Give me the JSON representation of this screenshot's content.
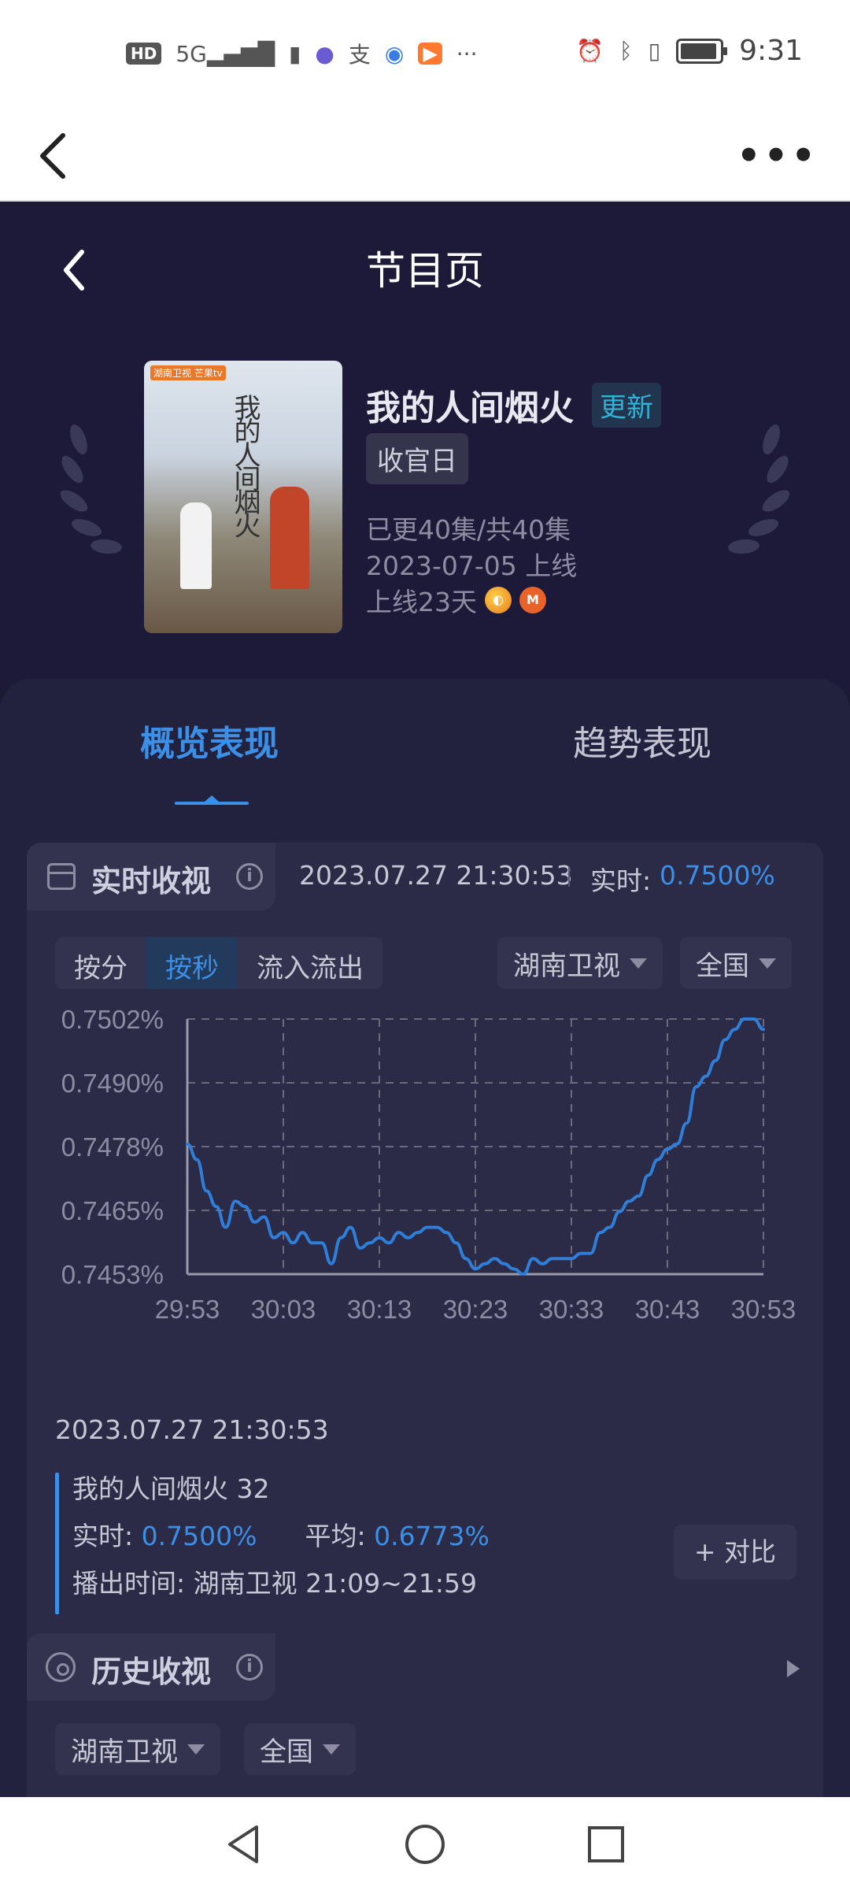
{
  "status_bar": {
    "time": "9:31",
    "left_icons": [
      "hd-icon",
      "signal-5g-icon",
      "battery-saver-icon",
      "app-icon-1",
      "alipay-icon",
      "app-icon-2",
      "app-icon-3",
      "more-notifications-icon"
    ],
    "right_icons": [
      "alarm-icon",
      "bluetooth-icon",
      "vibrate-icon",
      "battery-icon"
    ],
    "hd_label": "HD",
    "overflow": "···"
  },
  "top_nav": {
    "more": "•••"
  },
  "header": {
    "title": "节目页",
    "show_name": "我的人间烟火",
    "new_badge": "更新",
    "end_tag": "收官日",
    "episodes": "已更40集/共40集",
    "premiere": "2023-07-05 上线",
    "days_online": "上线23天",
    "platforms": [
      "hunan-tv-logo",
      "mango-tv-logo"
    ],
    "poster": {
      "title": "我的人间烟火",
      "badge": "湖南卫视 芒果tv"
    }
  },
  "tabs": [
    {
      "label": "概览表现",
      "active": true
    },
    {
      "label": "趋势表现",
      "active": false
    }
  ],
  "realtime": {
    "title": "实时收视",
    "timestamp": "2023.07.27 21:30:53",
    "live_label": "实时:",
    "live_value": "0.7500%",
    "segments": [
      {
        "label": "按分",
        "active": false
      },
      {
        "label": "按秒",
        "active": true
      },
      {
        "label": "流入流出",
        "active": false
      }
    ],
    "channel": "湖南卫视",
    "region": "全国"
  },
  "chart_data": {
    "type": "line",
    "x_ticks": [
      "29:53",
      "30:03",
      "30:13",
      "30:23",
      "30:33",
      "30:43",
      "30:53"
    ],
    "y_ticks": [
      "0.7502%",
      "0.7490%",
      "0.7478%",
      "0.7465%",
      "0.7453%"
    ],
    "ylim": [
      0.7453,
      0.7502
    ],
    "grid": true,
    "series": [
      {
        "color": "#2f7ed8",
        "x": [
          0,
          1,
          2,
          3,
          4,
          5,
          6,
          7,
          8,
          9,
          10,
          11,
          12,
          13,
          14,
          15,
          16,
          17,
          18,
          19,
          20,
          21,
          22,
          23,
          24,
          25,
          26,
          27,
          28,
          29,
          30,
          31,
          32,
          33,
          34,
          35,
          36,
          37,
          38,
          39,
          40,
          41,
          42,
          43,
          44,
          45,
          46,
          47,
          48,
          49,
          50,
          51,
          52,
          53,
          54,
          55,
          56,
          57,
          58,
          59,
          60
        ],
        "values": [
          0.7478,
          0.7475,
          0.7469,
          0.7466,
          0.7462,
          0.7467,
          0.7466,
          0.7463,
          0.7464,
          0.746,
          0.7461,
          0.7459,
          0.7461,
          0.7459,
          0.7459,
          0.7455,
          0.746,
          0.7462,
          0.7458,
          0.7459,
          0.746,
          0.7459,
          0.7461,
          0.746,
          0.7461,
          0.7462,
          0.7462,
          0.7461,
          0.7459,
          0.7456,
          0.7454,
          0.7455,
          0.7456,
          0.7455,
          0.7454,
          0.7453,
          0.7456,
          0.7455,
          0.7456,
          0.7456,
          0.7456,
          0.7457,
          0.7457,
          0.7461,
          0.7462,
          0.7465,
          0.7467,
          0.7468,
          0.7472,
          0.7475,
          0.7477,
          0.7478,
          0.7482,
          0.7489,
          0.7491,
          0.7494,
          0.7498,
          0.75,
          0.7502,
          0.7502,
          0.75
        ]
      }
    ]
  },
  "tooltip": {
    "timestamp": "2023.07.27 21:30:53",
    "episode": "我的人间烟火 32",
    "live_label": "实时:",
    "live_value": "0.7500%",
    "avg_label": "平均:",
    "avg_value": "0.6773%",
    "airing_label": "播出时间:",
    "airing_value": "湖南卫视 21:09~21:59",
    "compare_button": "+ 对比"
  },
  "history": {
    "title": "历史收视",
    "channel": "湖南卫视",
    "region": "全国"
  }
}
